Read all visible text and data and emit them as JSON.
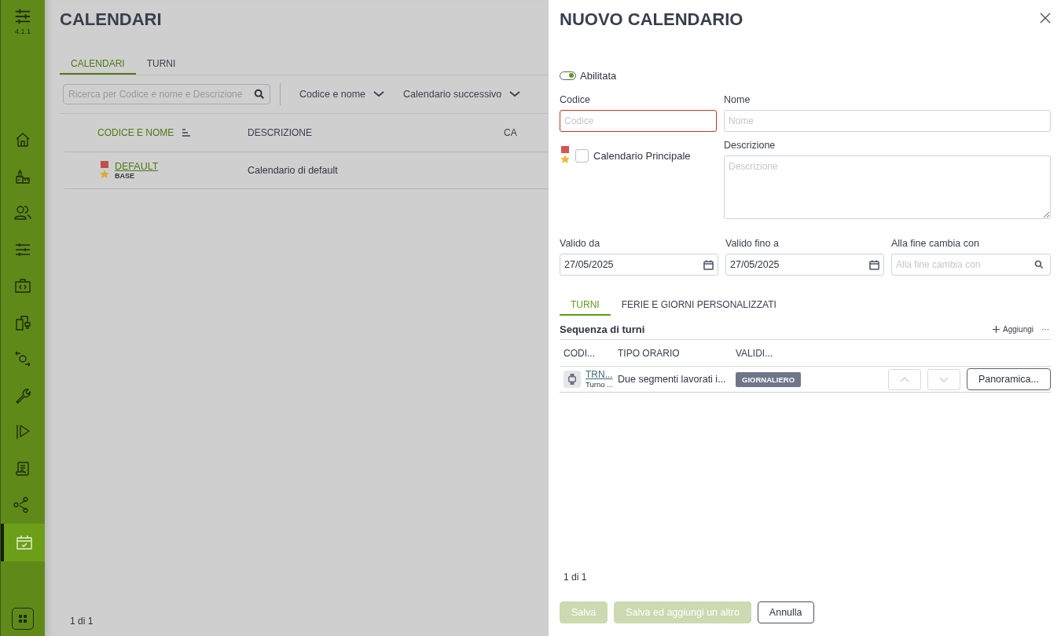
{
  "sidebar": {
    "version": "4.1.1",
    "items": [
      {
        "selected": false
      },
      {
        "selected": false
      },
      {
        "selected": false
      },
      {
        "selected": false
      },
      {
        "selected": false
      },
      {
        "selected": false
      },
      {
        "selected": false
      },
      {
        "selected": false
      },
      {
        "selected": false
      },
      {
        "selected": false
      },
      {
        "selected": false
      },
      {
        "selected": true
      }
    ]
  },
  "page": {
    "title": "CALENDARI",
    "tabs": [
      {
        "label": "CALENDARI",
        "selected": true
      },
      {
        "label": "TURNI",
        "selected": false
      }
    ],
    "search": {
      "placeholder": "Ricerca per Codice e nome e Descrizione"
    },
    "filters": [
      "Codice e nome",
      "Calendario successivo"
    ],
    "table": {
      "columns": [
        {
          "label": "CODICE E NOME",
          "sorted": true
        },
        {
          "label": "DESCRIZIONE",
          "sorted": false
        },
        {
          "label": "CA",
          "sorted": false
        }
      ],
      "rows": [
        {
          "code": "DEFAULT",
          "tag": "BASE",
          "description": "Calendario di default"
        }
      ]
    },
    "pager": "1 di 1"
  },
  "dialog": {
    "title": "NUOVO CALENDARIO",
    "toggle": {
      "label": "Abilitata",
      "on": true
    },
    "code": {
      "label": "Codice",
      "placeholder": "Codice",
      "invalid": true
    },
    "name": {
      "label": "Nome",
      "placeholder": "Nome"
    },
    "main_checkbox": {
      "label": "Calendario Principale",
      "checked": false
    },
    "description": {
      "label": "Descrizione",
      "placeholder": "Descrizione"
    },
    "valid_from": {
      "label": "Valido da",
      "value": "27/05/2025"
    },
    "valid_to": {
      "label": "Valido fino a",
      "value": "27/05/2025"
    },
    "next": {
      "label": "Alla fine cambia con",
      "placeholder": "Alla fine cambia con"
    },
    "tabs": [
      {
        "label": "TURNI",
        "selected": true
      },
      {
        "label": "FERIE E GIORNI PERSONALIZZATI",
        "selected": false
      }
    ],
    "section": {
      "title": "Sequenza di turni",
      "add": "Aggiungi",
      "more": "···"
    },
    "table": {
      "columns": [
        "CODI...",
        "TIPO ORARIO",
        "VALIDI..."
      ],
      "rows": [
        {
          "code": "TRN...",
          "name": "Turno ...",
          "type": "Due segmenti lavorati i...",
          "validity": "GIORNALIERO",
          "up_disabled": true,
          "down_disabled": true,
          "action": "Panoramica..."
        }
      ]
    },
    "pager": "1 di 1",
    "buttons": [
      {
        "label": "Salva",
        "kind": "primary",
        "disabled": true
      },
      {
        "label": "Salva ed aggiungi un altro",
        "kind": "primary",
        "disabled": true
      },
      {
        "label": "Annulla",
        "kind": "secondary",
        "disabled": false
      }
    ]
  }
}
